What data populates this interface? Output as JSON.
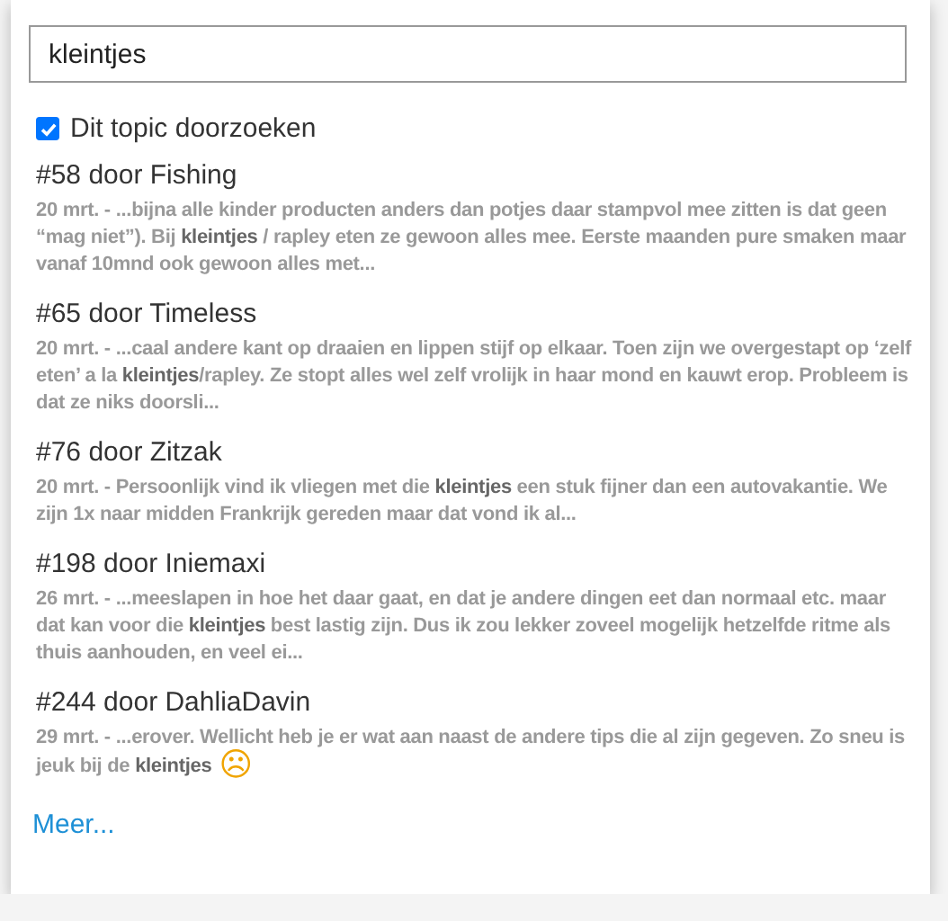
{
  "search": {
    "value": "kleintjes"
  },
  "scope_checkbox": {
    "label": "Dit topic doorzoeken",
    "checked": true
  },
  "results": [
    {
      "title": "#58 door Fishing",
      "snippet": "20 mrt. - ...bijna alle kinder producten anders dan potjes daar stampvol mee zitten is dat geen “mag niet”). Bij **kleintjes** / rapley eten ze gewoon alles mee. Eerste maanden pure smaken maar vanaf 10mnd ook gewoon alles met..."
    },
    {
      "title": "#65 door Timeless",
      "snippet": "20 mrt. - ...caal andere kant op draaien en lippen stijf op elkaar. Toen zijn we overgestapt op ‘zelf eten’ a la **kleintjes**/rapley. Ze stopt alles wel zelf vrolijk in haar mond en kauwt erop. Probleem is dat ze niks doorsli..."
    },
    {
      "title": "#76 door Zitzak",
      "snippet": "20 mrt. - Persoonlijk vind ik vliegen met die **kleintjes** een stuk fijner dan een autovakantie. We zijn 1x naar midden Frankrijk gereden maar dat vond ik al..."
    },
    {
      "title": "#198 door Iniemaxi",
      "snippet": "26 mrt. - ...meeslapen in hoe het daar gaat, en dat je andere dingen eet dan normaal etc. maar dat kan voor die **kleintjes** best lastig zijn. Dus ik zou lekker zoveel mogelijk hetzelfde ritme als thuis aanhouden, en veel ei..."
    },
    {
      "title": "#244 door DahliaDavin",
      "snippet": "29 mrt. - ...erover. Wellicht heb je er wat aan naast de andere tips die al zijn gegeven. Zo sneu is jeuk bij de **kleintjes**",
      "emoji": "☹"
    }
  ],
  "more_link": "Meer..."
}
